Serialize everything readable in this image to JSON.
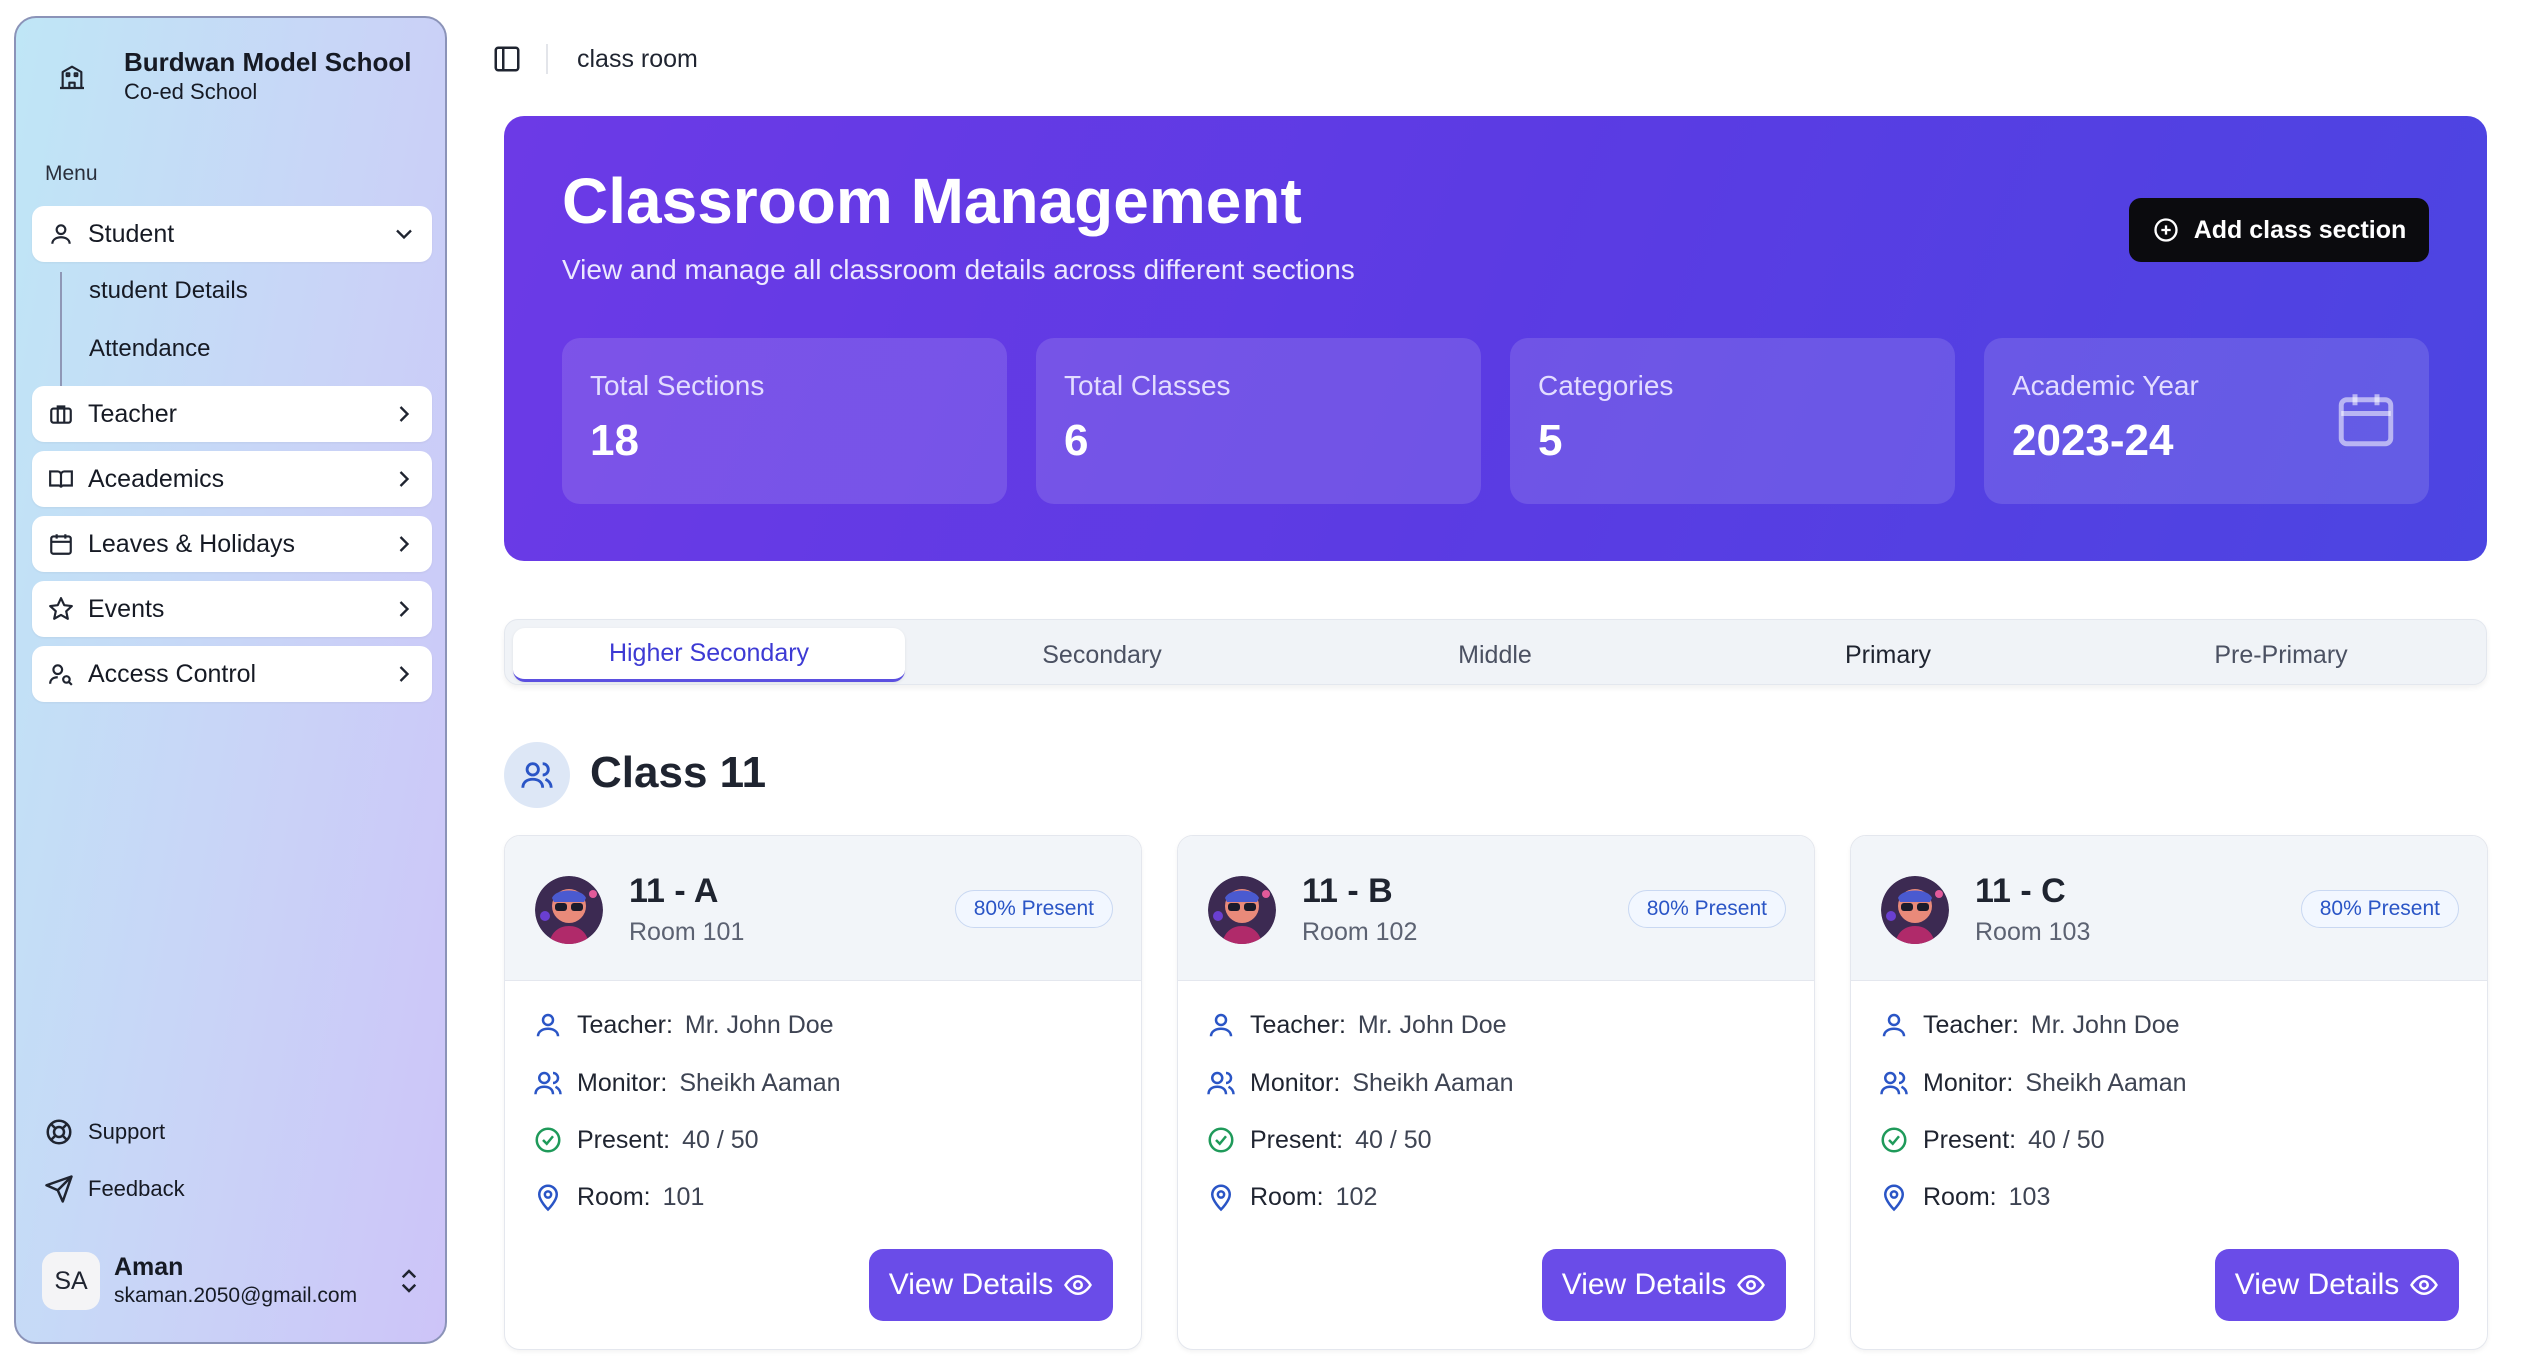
{
  "school": {
    "name": "Burdwan Model School",
    "type": "Co-ed School"
  },
  "sidebar": {
    "menu_label": "Menu",
    "items": [
      {
        "label": "Student",
        "icon": "user-icon"
      },
      {
        "label": "Teacher",
        "icon": "briefcase-icon"
      },
      {
        "label": "Aceademics",
        "icon": "book-icon"
      },
      {
        "label": "Leaves & Holidays",
        "icon": "calendar-icon"
      },
      {
        "label": "Events",
        "icon": "star-icon"
      },
      {
        "label": "Access Control",
        "icon": "user-key-icon"
      }
    ],
    "student_sub": [
      "student Details",
      "Attendance"
    ],
    "footer": [
      {
        "label": "Support",
        "icon": "lifebuoy-icon"
      },
      {
        "label": "Feedback",
        "icon": "send-icon"
      }
    ],
    "user": {
      "initials": "SA",
      "name": "Aman",
      "email": "skaman.2050@gmail.com"
    }
  },
  "topbar": {
    "breadcrumb": "class room"
  },
  "hero": {
    "title": "Classroom Management",
    "subtitle": "View and manage all classroom details across different sections",
    "add_button": "Add class section",
    "stats": [
      {
        "label": "Total Sections",
        "value": "18"
      },
      {
        "label": "Total Classes",
        "value": "6"
      },
      {
        "label": "Categories",
        "value": "5"
      },
      {
        "label": "Academic Year",
        "value": "2023-24"
      }
    ]
  },
  "tabs": [
    "Higher Secondary",
    "Secondary",
    "Middle",
    "Primary",
    "Pre-Primary"
  ],
  "active_tab": "Higher Secondary",
  "class_heading": "Class 11",
  "labels": {
    "teacher": "Teacher:",
    "monitor": "Monitor:",
    "present": "Present:",
    "room": "Room:",
    "view": "View Details"
  },
  "cards": [
    {
      "name": "11 - A",
      "room_label": "Room 101",
      "badge": "80% Present",
      "teacher": "Mr. John Doe",
      "monitor": "Sheikh Aaman",
      "present": "40 / 50",
      "room": "101"
    },
    {
      "name": "11 - B",
      "room_label": "Room 102",
      "badge": "80% Present",
      "teacher": "Mr. John Doe",
      "monitor": "Sheikh Aaman",
      "present": "40 / 50",
      "room": "102"
    },
    {
      "name": "11 - C",
      "room_label": "Room 103",
      "badge": "80% Present",
      "teacher": "Mr. John Doe",
      "monitor": "Sheikh Aaman",
      "present": "40 / 50",
      "room": "103"
    }
  ],
  "colors": {
    "accent": "#6a4ce8",
    "hero_start": "#6c3ae6",
    "hero_end": "#4c45e2",
    "badge_text": "#2a55c6"
  }
}
